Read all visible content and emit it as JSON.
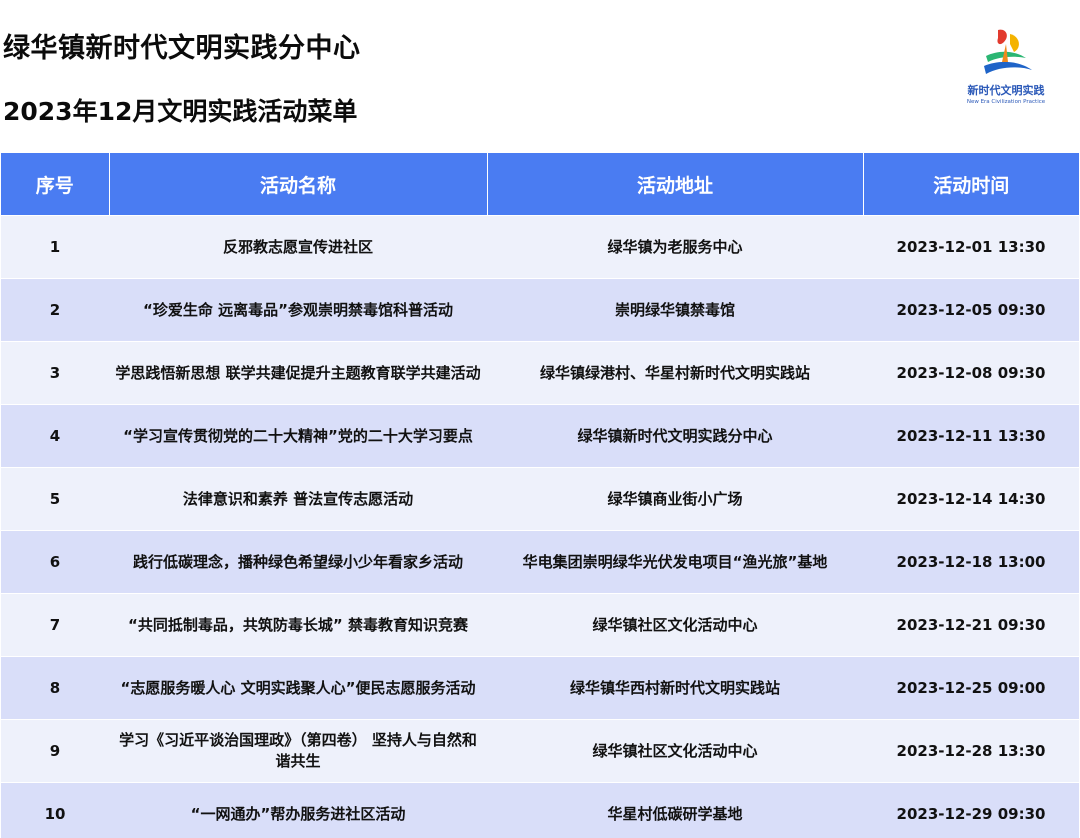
{
  "header": {
    "title": "绿华镇新时代文明实践分中心",
    "subtitle": "2023年12月文明实践活动菜单"
  },
  "logo": {
    "icon": "civilization-practice-logo-icon",
    "text_cn": "新时代文明实践",
    "text_en": "New Era Civilization Practice",
    "colors": [
      "#e23a2e",
      "#f4b300",
      "#2bb673",
      "#1f64c8"
    ]
  },
  "table": {
    "header_color": "#4a7cf2",
    "columns": [
      "序号",
      "活动名称",
      "活动地址",
      "活动时间"
    ],
    "rows": [
      {
        "no": "1",
        "name": "反邪教志愿宣传进社区",
        "address": "绿华镇为老服务中心",
        "time": "2023-12-01 13:30"
      },
      {
        "no": "2",
        "name": "“珍爱生命 远离毒品”参观崇明禁毒馆科普活动",
        "address": "崇明绿华镇禁毒馆",
        "time": "2023-12-05 09:30"
      },
      {
        "no": "3",
        "name": "学思践悟新思想 联学共建促提升主题教育联学共建活动",
        "address": "绿华镇绿港村、华星村新时代文明实践站",
        "time": "2023-12-08 09:30"
      },
      {
        "no": "4",
        "name": "“学习宣传贯彻党的二十大精神”党的二十大学习要点",
        "address": "绿华镇新时代文明实践分中心",
        "time": "2023-12-11 13:30"
      },
      {
        "no": "5",
        "name": "法律意识和素养 普法宣传志愿活动",
        "address": "绿华镇商业街小广场",
        "time": "2023-12-14 14:30"
      },
      {
        "no": "6",
        "name": "践行低碳理念，播种绿色希望绿小少年看家乡活动",
        "address": "华电集团崇明绿华光伏发电项目“渔光旅”基地",
        "time": "2023-12-18 13:00"
      },
      {
        "no": "7",
        "name": "“共同抵制毒品，共筑防毒长城” 禁毒教育知识竞赛",
        "address": "绿华镇社区文化活动中心",
        "time": "2023-12-21 09:30"
      },
      {
        "no": "8",
        "name": "“志愿服务暖人心 文明实践聚人心”便民志愿服务活动",
        "address": "绿华镇华西村新时代文明实践站",
        "time": "2023-12-25 09:00"
      },
      {
        "no": "9",
        "name": "学习《习近平谈治国理政》（第四卷） 坚持人与自然和谐共生",
        "address": "绿华镇社区文化活动中心",
        "time": "2023-12-28 13:30"
      },
      {
        "no": "10",
        "name": "“一网通办”帮办服务进社区活动",
        "address": "华星村低碳研学基地",
        "time": "2023-12-29 09:30"
      }
    ]
  }
}
